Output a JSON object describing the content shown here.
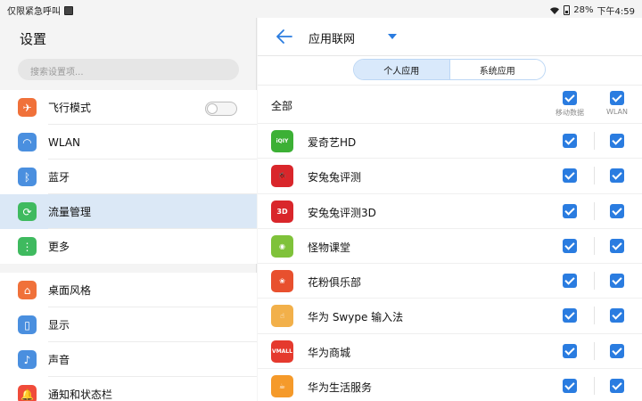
{
  "status_bar": {
    "left_text": "仅限紧急呼叫",
    "battery": "28%",
    "time": "下午4:59"
  },
  "left_panel": {
    "title": "设置",
    "search_placeholder": "搜索设置项...",
    "group1": [
      {
        "label": "飞行模式",
        "icon": "airplane-icon",
        "color": "#f0713a",
        "toggle": false
      },
      {
        "label": "WLAN",
        "icon": "wifi-icon",
        "color": "#4a8fdf"
      },
      {
        "label": "蓝牙",
        "icon": "bluetooth-icon",
        "color": "#4a8fdf"
      },
      {
        "label": "流量管理",
        "icon": "data-usage-icon",
        "color": "#3fba5f",
        "selected": true
      },
      {
        "label": "更多",
        "icon": "more-icon",
        "color": "#3fba5f"
      }
    ],
    "group2": [
      {
        "label": "桌面风格",
        "icon": "home-style-icon",
        "color": "#f0713a"
      },
      {
        "label": "显示",
        "icon": "display-icon",
        "color": "#4a8fdf"
      },
      {
        "label": "声音",
        "icon": "sound-icon",
        "color": "#4a8fdf"
      },
      {
        "label": "通知和状态栏",
        "icon": "notification-icon",
        "color": "#f04b3a"
      }
    ]
  },
  "right_panel": {
    "title": "应用联网",
    "tabs": [
      "个人应用",
      "系统应用"
    ],
    "active_tab": 0,
    "all_label": "全部",
    "col_mobile": "移动数据",
    "col_wlan": "WLAN",
    "apps": [
      {
        "name": "爱奇艺HD",
        "icon": "iqiyi-icon",
        "color": "#3cb035",
        "glyph": "iQIY"
      },
      {
        "name": "安兔兔评测",
        "icon": "antutu-icon",
        "color": "#d9262b",
        "glyph": "🐞"
      },
      {
        "name": "安兔兔评测3D",
        "icon": "antutu-3d-icon",
        "color": "#d9262b",
        "glyph": "3D"
      },
      {
        "name": "怪物课堂",
        "icon": "monster-class-icon",
        "color": "#7fc23a",
        "glyph": "◉"
      },
      {
        "name": "花粉俱乐部",
        "icon": "huafen-club-icon",
        "color": "#e8502e",
        "glyph": "❀"
      },
      {
        "name": "华为 Swype 输入法",
        "icon": "swype-icon",
        "color": "#f2b04a",
        "glyph": "☝"
      },
      {
        "name": "华为商城",
        "icon": "vmall-icon",
        "color": "#e53a2e",
        "glyph": "VMALL"
      },
      {
        "name": "华为生活服务",
        "icon": "life-service-icon",
        "color": "#f59a2a",
        "glyph": "☕"
      }
    ]
  },
  "colors": {
    "accent": "#2a7ce0",
    "selected_row": "#dbe8f6"
  }
}
